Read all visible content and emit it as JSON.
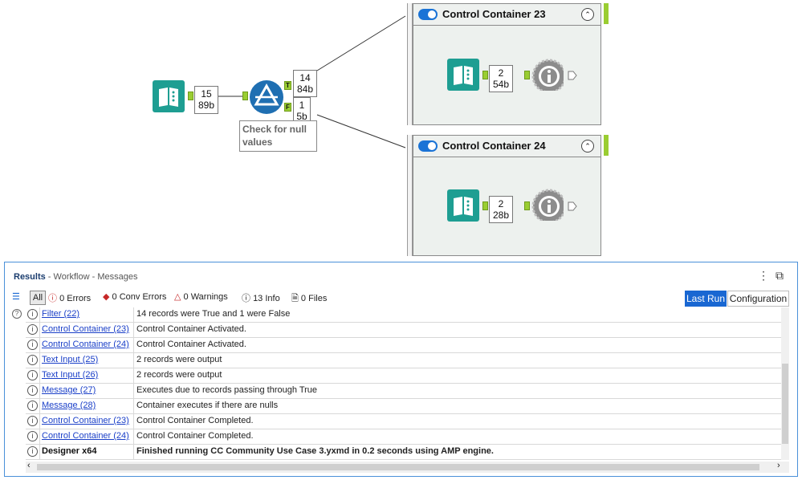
{
  "canvas": {
    "input_tool": {
      "count": "15",
      "size": "89b"
    },
    "filter_tool": {
      "true_anchor": "T",
      "false_anchor": "F",
      "true_count": "14",
      "true_size": "84b",
      "false_count": "1",
      "false_size": "5b",
      "annotation": "Check for null values"
    },
    "containers": [
      {
        "title": "Control Container 23",
        "count": "2",
        "size": "54b"
      },
      {
        "title": "Control Container 24",
        "count": "2",
        "size": "28b"
      }
    ]
  },
  "results": {
    "title": "Results",
    "subtitle": " - Workflow - Messages",
    "filters": {
      "all": "All",
      "errors": "0 Errors",
      "conv_errors": "0 Conv Errors",
      "warnings": "0 Warnings",
      "info": "13 Info",
      "files": "0 Files"
    },
    "last_run": "Last Run",
    "configuration": "Configuration",
    "rows": [
      {
        "tool": "Filter (22)",
        "message": "14 records were True and 1 were False"
      },
      {
        "tool": "Control Container (23)",
        "message": "Control Container Activated."
      },
      {
        "tool": "Control Container (24)",
        "message": "Control Container Activated."
      },
      {
        "tool": "Text Input (25)",
        "message": "2 records were output"
      },
      {
        "tool": "Text Input (26)",
        "message": "2 records were output"
      },
      {
        "tool": "Message (27)",
        "message": "Executes due to records passing through True"
      },
      {
        "tool": "Message (28)",
        "message": "Container executes if there are nulls"
      },
      {
        "tool": "Control Container (23)",
        "message": "Control Container Completed."
      },
      {
        "tool": "Control Container (24)",
        "message": "Control Container Completed."
      },
      {
        "tool": "Designer x64",
        "message": "Finished running CC Community Use Case 3.yxmd in 0.2 seconds using AMP engine."
      }
    ]
  },
  "colors": {
    "tool_teal": "#1e9e92",
    "filter_blue": "#1f6fb2",
    "anchor_green": "#9acd32",
    "toggle_blue": "#1a73d6",
    "accent_blue": "#1967d2",
    "info_gray": "#8c8c8c"
  }
}
